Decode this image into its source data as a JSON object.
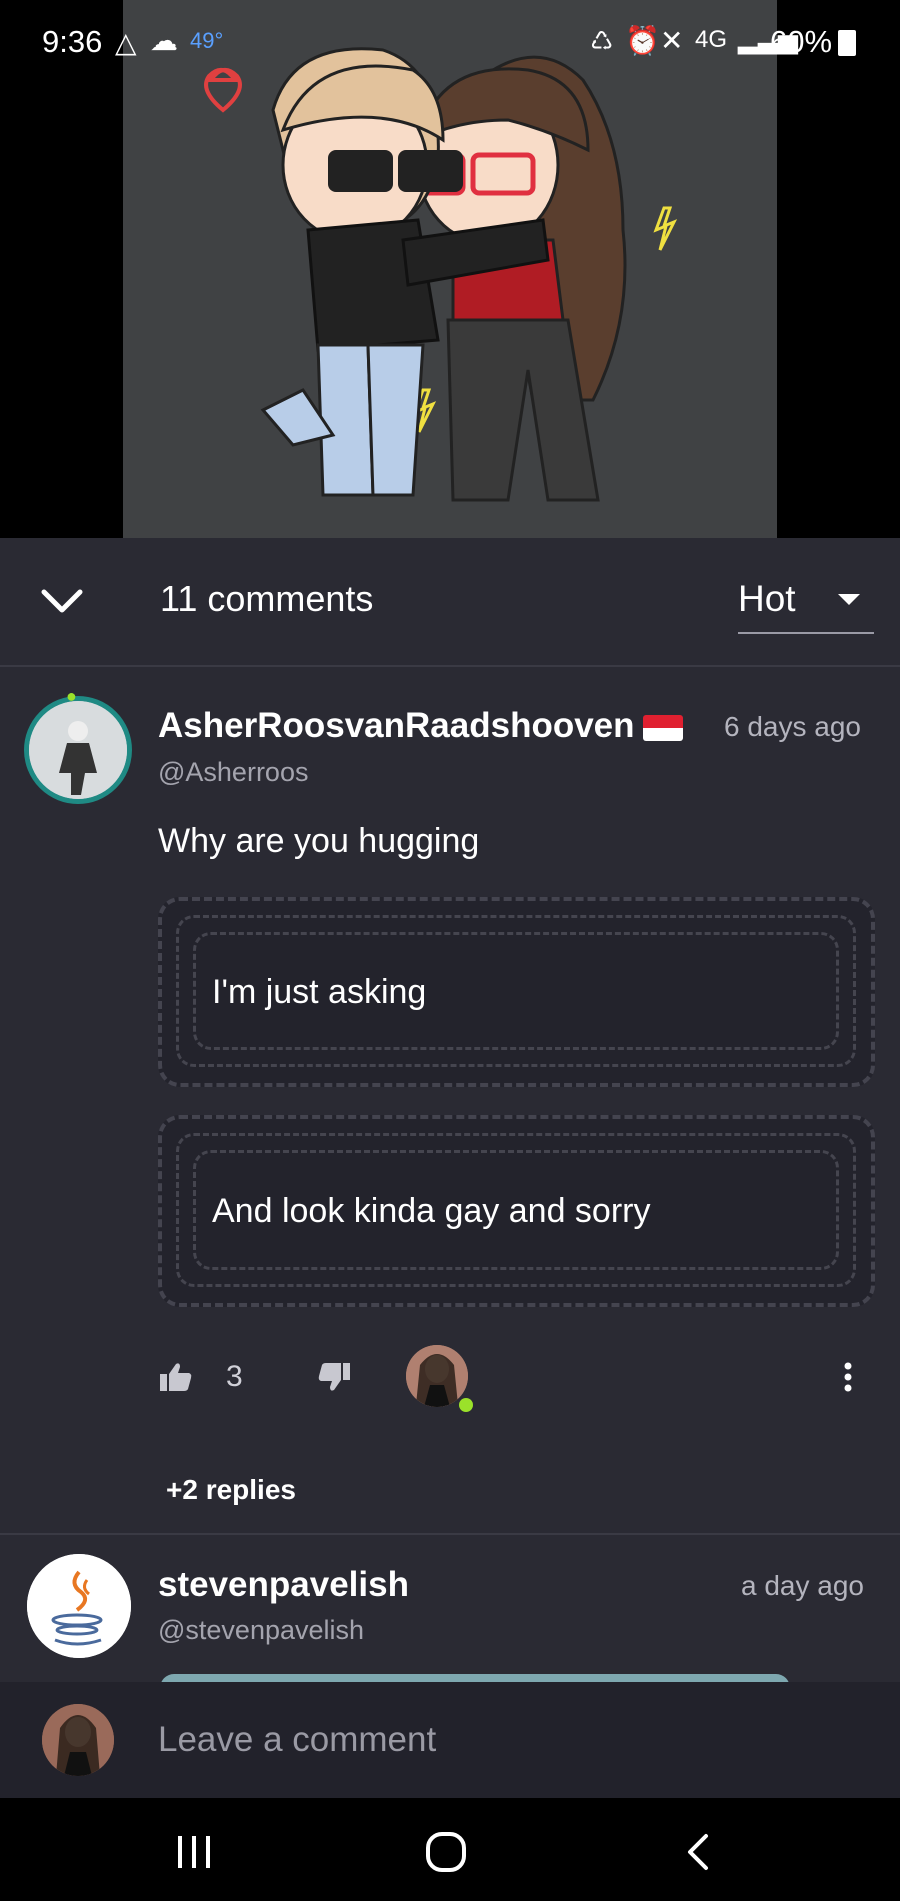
{
  "status_bar": {
    "time": "9:36",
    "temperature": "49°",
    "battery": "60%"
  },
  "comments_header": {
    "count_label": "11 comments",
    "sort_value": "Hot"
  },
  "comments": [
    {
      "author": "AsherRoosvanRaadshooven",
      "handle": "@Asherroos",
      "time": "6 days ago",
      "text": "Why are you hugging",
      "bubbles": [
        "I'm just asking",
        "And look kinda gay and sorry"
      ],
      "likes": "3",
      "replies_label": "+2 replies"
    },
    {
      "author": "stevenpavelish",
      "handle": "@stevenpavelish",
      "time": "a day ago"
    }
  ],
  "comment_input": {
    "placeholder": "Leave a comment"
  },
  "colors": {
    "background": "#2a2a33",
    "avatar_ring": "#1f8a84",
    "online_dot": "#9be12a"
  }
}
